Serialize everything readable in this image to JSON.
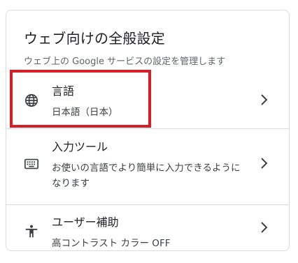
{
  "header": {
    "title": "ウェブ向けの全般設定",
    "subtitle": "ウェブ上の Google サービスの設定を管理します"
  },
  "settings": [
    {
      "icon": "globe-icon",
      "title": "言語",
      "value": "日本語（日本）"
    },
    {
      "icon": "keyboard-icon",
      "title": "入力ツール",
      "value": "お使いの言語でより簡単に入力できるようになります"
    },
    {
      "icon": "accessibility-icon",
      "title": "ユーザー補助",
      "value": "高コントラスト カラー OFF"
    }
  ],
  "colors": {
    "highlight": "#d51f27",
    "border": "#dadce0",
    "text_primary": "#202124",
    "text_secondary": "#5f6368"
  }
}
